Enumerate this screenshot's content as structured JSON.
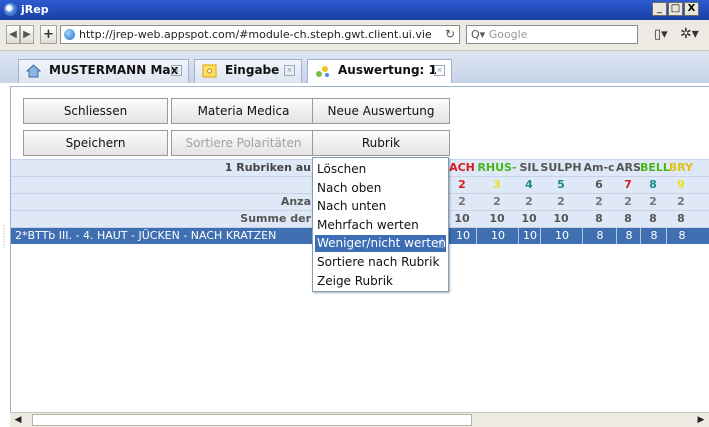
{
  "window": {
    "title": "jRep",
    "buttons": [
      "_",
      "□",
      "X"
    ]
  },
  "address": {
    "url": "http://jrep-web.appspot.com/#module-ch.steph.gwt.client.ui.vie",
    "search_placeholder": "Google"
  },
  "tabs": [
    {
      "label": "MUSTERMANN Max",
      "icon": "house-icon"
    },
    {
      "label": "Eingabe",
      "icon": "dot-icon"
    },
    {
      "label": "Auswertung: 1",
      "icon": "chart-icon"
    }
  ],
  "buttons": {
    "close": "Schliessen",
    "materia": "Materia Medica",
    "new_eval": "Neue Auswertung",
    "save": "Speichern",
    "sort_pol": "Sortiere Polaritäten",
    "rubrik": "Rubrik"
  },
  "grid": {
    "header_label": "1 Rubriken au",
    "count_label": "Anza",
    "sum_label": "Summe der",
    "rubric_text": "2*BTTb  III. - 4. HAUT - JÜCKEN - NACH KRATZEN",
    "columns": [
      {
        "name": "ACH",
        "color": "#d51d1d",
        "count": "2",
        "count_color": "#d51d1d",
        "anzahl": "2",
        "summe": "10",
        "row": "10"
      },
      {
        "name": "RHUS-T",
        "color": "#49b51c",
        "count": "3",
        "count_color": "#e8e21b",
        "anzahl": "2",
        "summe": "10",
        "row": "10"
      },
      {
        "name": "SIL",
        "color": "#555555",
        "count": "4",
        "count_color": "#1a8a8a",
        "anzahl": "2",
        "summe": "10",
        "row": "10"
      },
      {
        "name": "SULPH",
        "color": "#555555",
        "count": "5",
        "count_color": "#1a8a8a",
        "anzahl": "2",
        "summe": "10",
        "row": "10"
      },
      {
        "name": "Am-c",
        "color": "#555555",
        "count": "6",
        "count_color": "#555555",
        "anzahl": "2",
        "summe": "8",
        "row": "8"
      },
      {
        "name": "ARS",
        "color": "#555555",
        "count": "7",
        "count_color": "#d51d1d",
        "anzahl": "2",
        "summe": "8",
        "row": "8"
      },
      {
        "name": "BELL",
        "color": "#49b51c",
        "count": "8",
        "count_color": "#1a8a8a",
        "anzahl": "2",
        "summe": "8",
        "row": "8"
      },
      {
        "name": "BRY",
        "color": "#e0c21b",
        "count": "9",
        "count_color": "#e8e21b",
        "anzahl": "2",
        "summe": "8",
        "row": "8"
      }
    ]
  },
  "menu": [
    "Löschen",
    "Nach oben",
    "Nach unten",
    "Mehrfach werten",
    "Weniger/nicht werten",
    "Sortiere nach Rubrik",
    "Zeige Rubrik"
  ],
  "menu_highlight_index": 4
}
